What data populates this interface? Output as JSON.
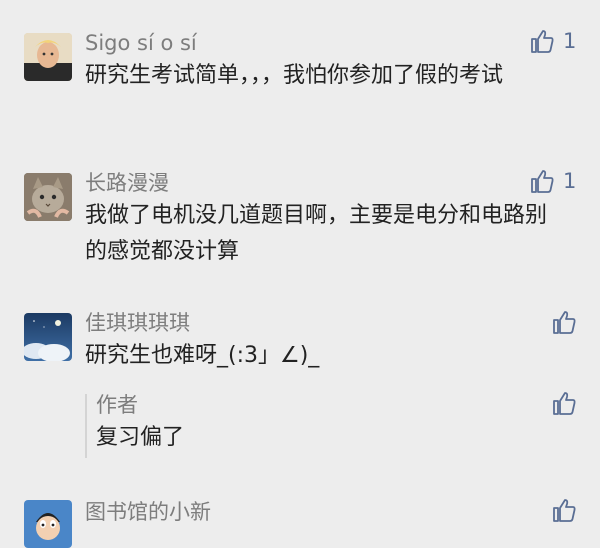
{
  "comments": [
    {
      "user": "Sigo sí o sí",
      "text": "研究生考试简单，，，我怕你参加了假的考试",
      "likes": "1",
      "avatar_icon": "user-photo-avatar"
    },
    {
      "user": "长路漫漫",
      "text": "我做了电机没几道题目啊，主要是电分和电路别的感觉都没计算",
      "likes": "1",
      "avatar_icon": "cat-photo-avatar"
    },
    {
      "user": "佳琪琪琪琪",
      "text": "研究生也难呀_(:3」∠)_",
      "likes": "",
      "avatar_icon": "night-sky-avatar",
      "reply": {
        "author": "作者",
        "text": "复习偏了"
      }
    },
    {
      "user": "图书馆的小新",
      "text": "",
      "likes": "",
      "avatar_icon": "cartoon-avatar"
    }
  ],
  "colors": {
    "background": "#ededed",
    "like_icon": "#5a6e94",
    "name": "#7d7d7d",
    "text": "#222222"
  }
}
